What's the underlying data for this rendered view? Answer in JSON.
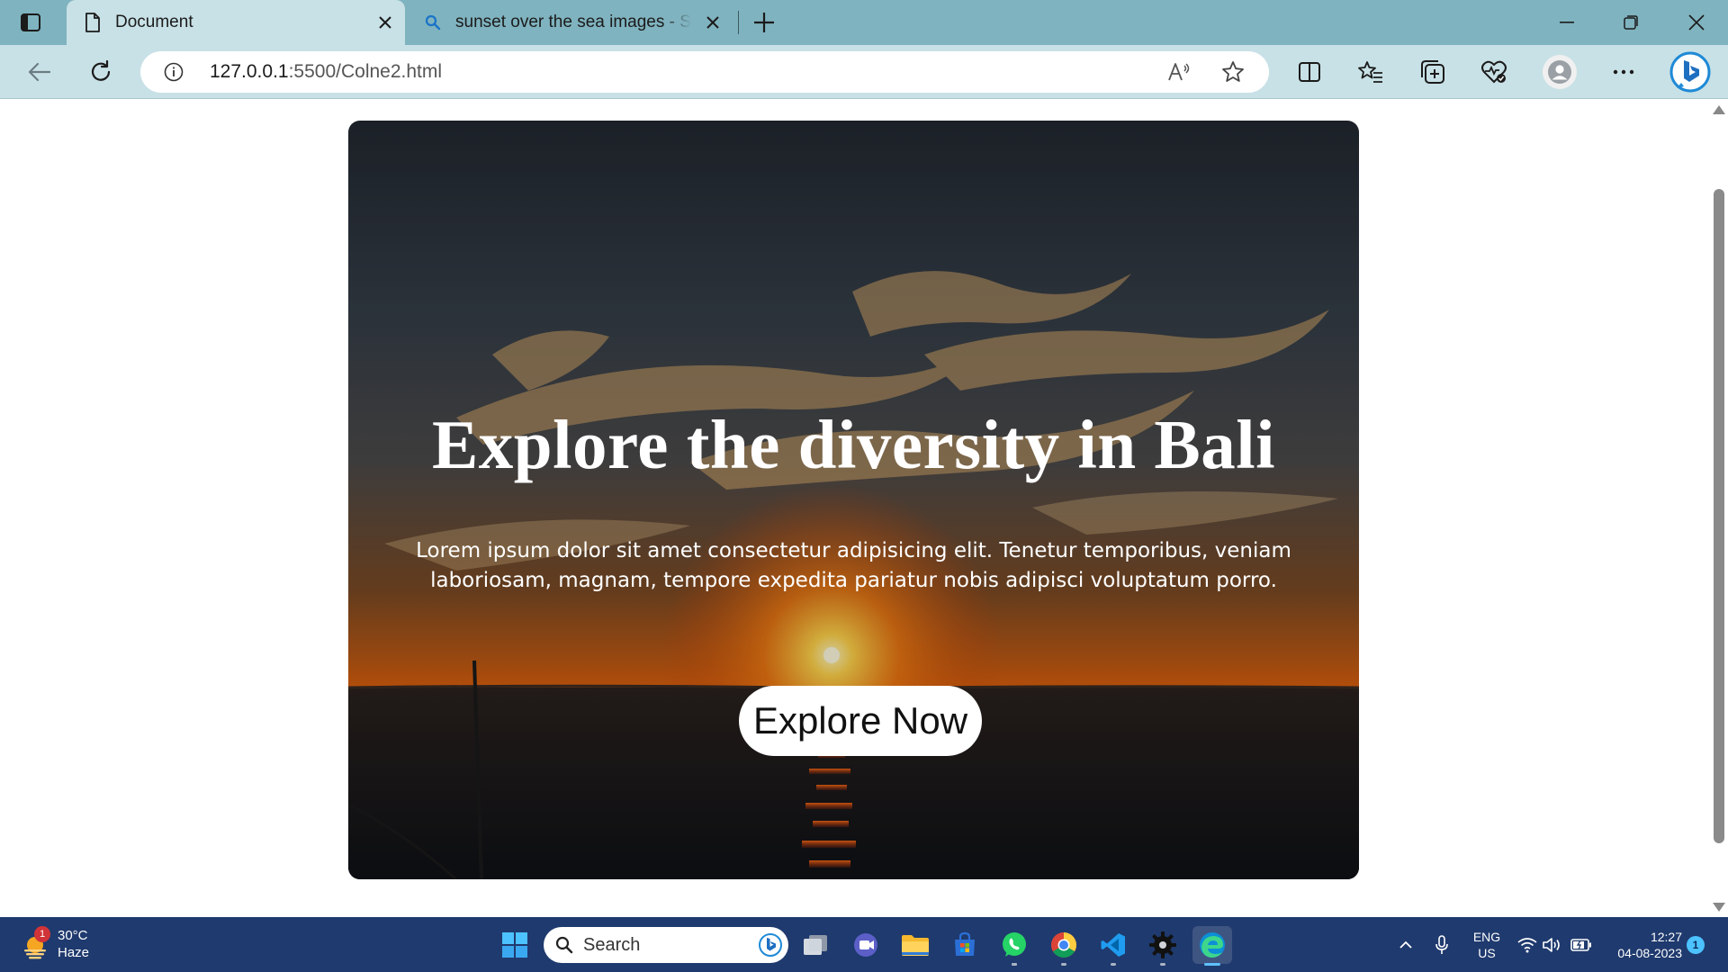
{
  "browser": {
    "tabs": [
      {
        "title": "Document",
        "active": true
      },
      {
        "title": "sunset over the sea images - Search",
        "active": false
      }
    ],
    "address": {
      "host": "127.0.0.1",
      "path": ":5500/Colne2.html"
    },
    "icons": {
      "tab_actions": "tab-actions-icon",
      "document": "document-icon",
      "search": "search-icon",
      "close": "close-icon",
      "new_tab": "plus-icon",
      "minimize": "minimize-icon",
      "restore": "restore-icon",
      "window_close": "close-icon",
      "back": "back-arrow-icon",
      "refresh": "refresh-icon",
      "info": "info-icon",
      "read_aloud": "read-aloud-icon",
      "favorite": "star-icon",
      "split_screen": "split-screen-icon",
      "favorites": "favorites-icon",
      "collections": "collections-icon",
      "browser_essentials": "heart-pulse-icon",
      "profile": "profile-icon",
      "more": "more-icon",
      "bing": "bing-icon"
    },
    "colors": {
      "tab_strip": "#7fb3bf",
      "toolbar": "#c8e1e6"
    }
  },
  "page": {
    "hero": {
      "title": "Explore the diversity in Bali",
      "text": "Lorem ipsum dolor sit amet consectetur adipisicing elit. Tenetur temporibus, veniam laboriosam, magnam, tempore expedita pariatur nobis adipisci voluptatum porro.",
      "button": "Explore Now",
      "background": "sunset-over-sea-image"
    }
  },
  "taskbar": {
    "weather": {
      "temp": "30°C",
      "condition": "Haze",
      "badge": "1"
    },
    "search_label": "Search",
    "apps": [
      "start",
      "search",
      "task-view",
      "teams",
      "file-explorer",
      "store",
      "whatsapp",
      "chrome",
      "vscode",
      "settings",
      "edge"
    ],
    "tray": {
      "language_top": "ENG",
      "language_bottom": "US",
      "time": "12:27",
      "date": "04-08-2023",
      "notifications": "1"
    },
    "colors": {
      "background": "#1f3a6e"
    }
  }
}
